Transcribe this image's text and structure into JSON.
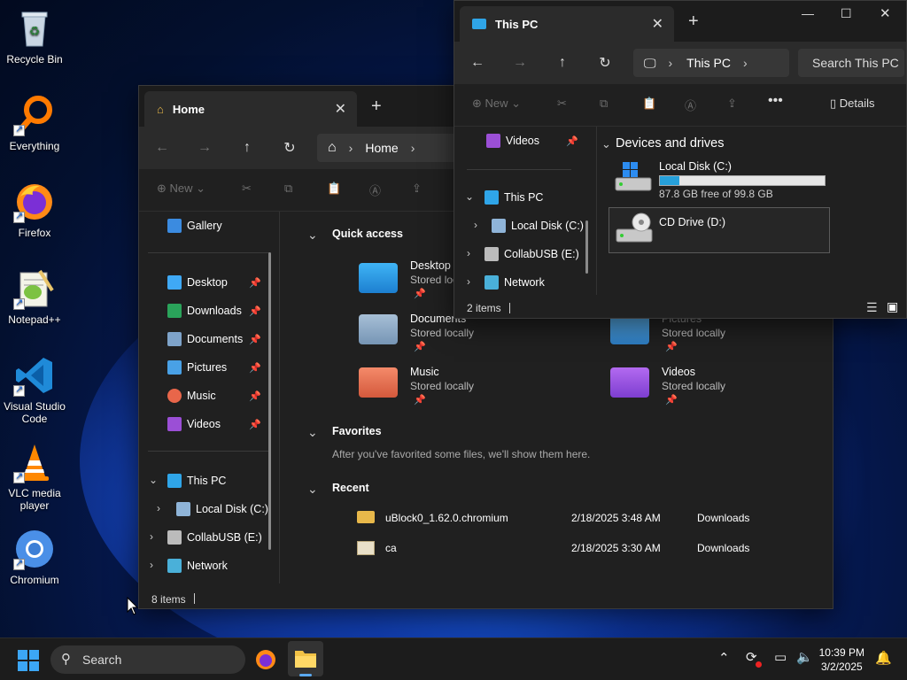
{
  "desktop": {
    "icons": [
      {
        "label": "Recycle Bin"
      },
      {
        "label": "Everything"
      },
      {
        "label": "Firefox"
      },
      {
        "label": "Notepad++"
      },
      {
        "label": "Visual Studio Code"
      },
      {
        "label": "VLC media player"
      },
      {
        "label": "Chromium"
      }
    ]
  },
  "home_window": {
    "tab_title": "Home",
    "breadcrumb": "Home",
    "cmd_new": "New",
    "nav": {
      "gallery": "Gallery",
      "desktop": "Desktop",
      "downloads": "Downloads",
      "documents": "Documents",
      "pictures": "Pictures",
      "music": "Music",
      "videos": "Videos",
      "this_pc": "This PC",
      "local_disk": "Local Disk (C:)",
      "collab_usb": "CollabUSB (E:)",
      "network": "Network"
    },
    "quick_access_header": "Quick access",
    "quick_access": [
      {
        "name": "Desktop",
        "sub": "Stored locally"
      },
      {
        "name": "Documents",
        "sub": "Stored locally"
      },
      {
        "name": "Pictures",
        "sub": "Stored locally"
      },
      {
        "name": "Music",
        "sub": "Stored locally"
      },
      {
        "name": "Videos",
        "sub": "Stored locally"
      }
    ],
    "favorites_header": "Favorites",
    "favorites_empty": "After you've favorited some files, we'll show them here.",
    "recent_header": "Recent",
    "recent": [
      {
        "name": "uBlock0_1.62.0.chromium",
        "date": "2/18/2025 3:48 AM",
        "location": "Downloads"
      },
      {
        "name": "ca",
        "date": "2/18/2025 3:30 AM",
        "location": "Downloads"
      }
    ],
    "status": "8 items"
  },
  "thispc_window": {
    "tab_title": "This PC",
    "breadcrumb": "This PC",
    "search_placeholder": "Search This PC",
    "cmd_new": "New",
    "details_label": "Details",
    "nav": {
      "videos": "Videos",
      "this_pc": "This PC",
      "local_disk": "Local Disk (C:)",
      "collab_usb": "CollabUSB (E:)",
      "network": "Network"
    },
    "section_header": "Devices and drives",
    "drives": [
      {
        "name": "Local Disk (C:)",
        "free": "87.8 GB free of 99.8 GB",
        "used_fraction": 0.12
      },
      {
        "name": "CD Drive (D:)"
      }
    ],
    "status": "2 items"
  },
  "taskbar": {
    "search_label": "Search",
    "time": "10:39 PM",
    "date": "3/2/2025"
  }
}
